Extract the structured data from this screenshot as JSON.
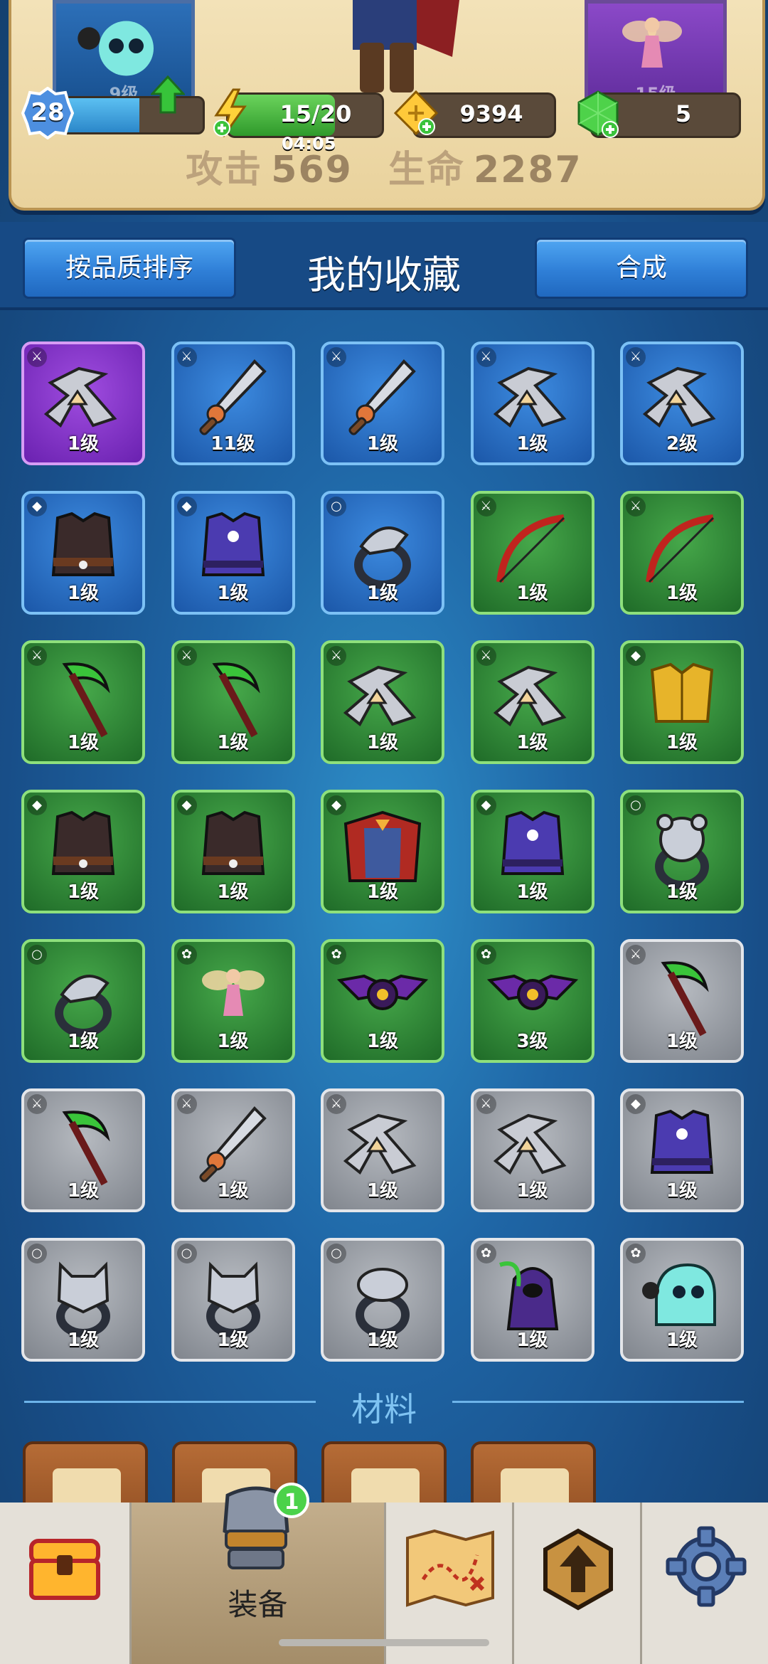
{
  "hero": {
    "player_level": "28",
    "left_card_level": "9级",
    "right_card_level": "15级",
    "energy": "15/20",
    "energy_timer": "04:05",
    "gold": "9394",
    "gems": "5",
    "attack_label": "攻击",
    "attack_value": "569",
    "hp_label": "生命",
    "hp_value": "2287",
    "xp_fraction": 0.55
  },
  "header": {
    "sort_button": "按品质排序",
    "title": "我的收藏",
    "merge_button": "合成"
  },
  "collection": [
    {
      "item": "shuriken",
      "rarity": "purple",
      "slot": "weapon",
      "level": "1级"
    },
    {
      "item": "sword",
      "rarity": "blue",
      "slot": "weapon",
      "level": "11级"
    },
    {
      "item": "sword",
      "rarity": "blue",
      "slot": "weapon",
      "level": "1级"
    },
    {
      "item": "shuriken",
      "rarity": "blue",
      "slot": "weapon",
      "level": "1级"
    },
    {
      "item": "shuriken",
      "rarity": "blue",
      "slot": "weapon",
      "level": "2级"
    },
    {
      "item": "vest-dark",
      "rarity": "blue",
      "slot": "armor",
      "level": "1级"
    },
    {
      "item": "vest-purple",
      "rarity": "blue",
      "slot": "armor",
      "level": "1级"
    },
    {
      "item": "ring-eagle",
      "rarity": "blue",
      "slot": "ring",
      "level": "1级"
    },
    {
      "item": "bow",
      "rarity": "green",
      "slot": "weapon",
      "level": "1级"
    },
    {
      "item": "bow",
      "rarity": "green",
      "slot": "weapon",
      "level": "1级"
    },
    {
      "item": "scythe",
      "rarity": "green",
      "slot": "weapon",
      "level": "1级"
    },
    {
      "item": "scythe",
      "rarity": "green",
      "slot": "weapon",
      "level": "1级"
    },
    {
      "item": "shuriken",
      "rarity": "green",
      "slot": "weapon",
      "level": "1级"
    },
    {
      "item": "shuriken",
      "rarity": "green",
      "slot": "weapon",
      "level": "1级"
    },
    {
      "item": "armor-gold",
      "rarity": "green",
      "slot": "armor",
      "level": "1级"
    },
    {
      "item": "vest-dark",
      "rarity": "green",
      "slot": "armor",
      "level": "1级"
    },
    {
      "item": "vest-dark",
      "rarity": "green",
      "slot": "armor",
      "level": "1级"
    },
    {
      "item": "vest-cape",
      "rarity": "green",
      "slot": "armor",
      "level": "1级"
    },
    {
      "item": "vest-purple",
      "rarity": "green",
      "slot": "armor",
      "level": "1级"
    },
    {
      "item": "ring-bear",
      "rarity": "green",
      "slot": "ring",
      "level": "1级"
    },
    {
      "item": "ring-eagle",
      "rarity": "green",
      "slot": "ring",
      "level": "1级"
    },
    {
      "item": "pet-fairy",
      "rarity": "green",
      "slot": "pet",
      "level": "1级"
    },
    {
      "item": "pet-bat",
      "rarity": "green",
      "slot": "pet",
      "level": "1级"
    },
    {
      "item": "pet-bat",
      "rarity": "green",
      "slot": "pet",
      "level": "3级"
    },
    {
      "item": "scythe",
      "rarity": "gray",
      "slot": "weapon",
      "level": "1级"
    },
    {
      "item": "scythe",
      "rarity": "gray",
      "slot": "weapon",
      "level": "1级"
    },
    {
      "item": "sword",
      "rarity": "gray",
      "slot": "weapon",
      "level": "1级"
    },
    {
      "item": "shuriken",
      "rarity": "gray",
      "slot": "weapon",
      "level": "1级"
    },
    {
      "item": "shuriken",
      "rarity": "gray",
      "slot": "weapon",
      "level": "1级"
    },
    {
      "item": "vest-purple",
      "rarity": "gray",
      "slot": "armor",
      "level": "1级"
    },
    {
      "item": "ring-wolf",
      "rarity": "gray",
      "slot": "ring",
      "level": "1级"
    },
    {
      "item": "ring-wolf",
      "rarity": "gray",
      "slot": "ring",
      "level": "1级"
    },
    {
      "item": "ring-snake",
      "rarity": "gray",
      "slot": "ring",
      "level": "1级"
    },
    {
      "item": "pet-reaper",
      "rarity": "gray",
      "slot": "pet",
      "level": "1级"
    },
    {
      "item": "pet-ghost",
      "rarity": "gray",
      "slot": "pet",
      "level": "1级"
    }
  ],
  "materials": {
    "label": "材料",
    "count_visible": 4
  },
  "nav": {
    "equip_label": "装备",
    "equip_badge": "1",
    "tabs": [
      "chest-icon",
      "equipment-icon",
      "map-icon",
      "upgrade-icon",
      "settings-icon"
    ]
  },
  "colors": {
    "blue": "#2f7fd7",
    "green": "#3a9a3e",
    "purple": "#8c3fd0",
    "gray": "#9a9ea5"
  }
}
